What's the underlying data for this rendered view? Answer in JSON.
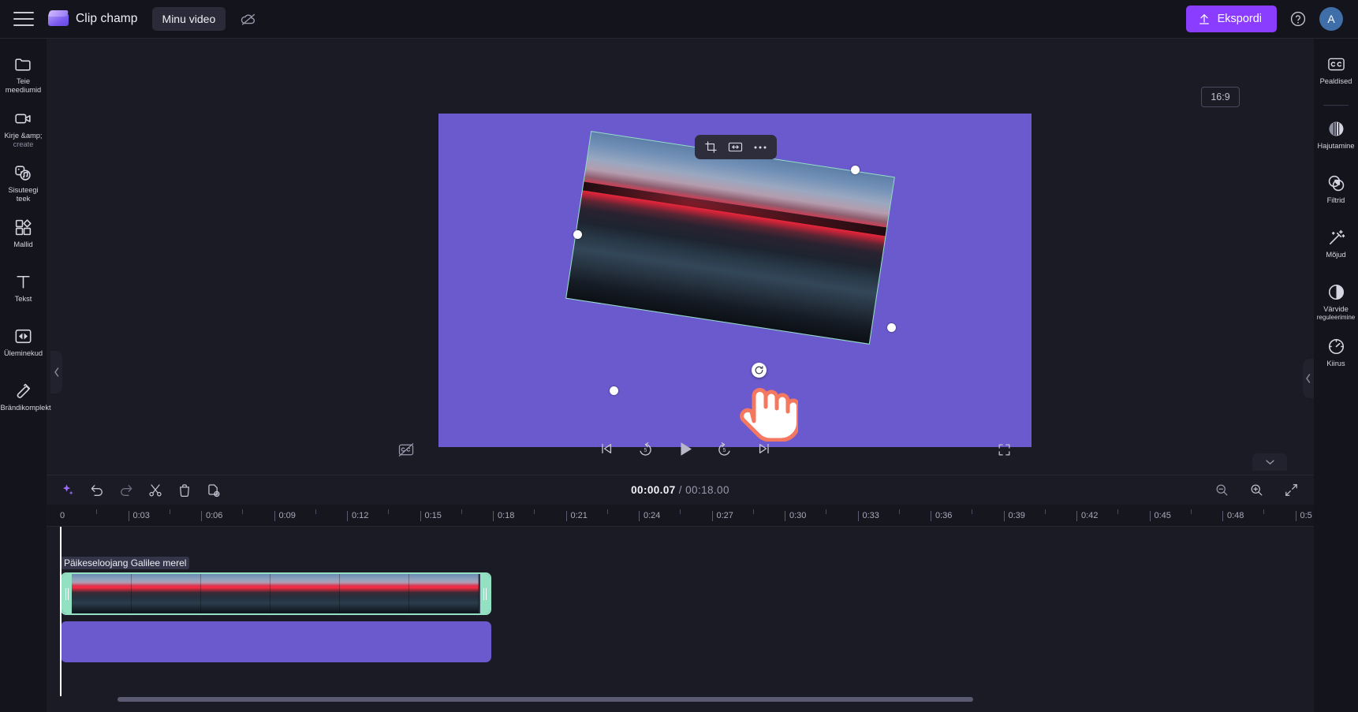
{
  "app": {
    "brand_name": "Clip champ",
    "project_name": "Minu video",
    "export_label": "Ekspordi",
    "avatar_initial": "A",
    "accent_color": "#8b3dff",
    "selection_color": "#93e0c3",
    "canvas_color": "#6a5acd"
  },
  "topbar": {
    "menu_icon": "hamburger-icon",
    "logo_icon": "clipchamp-logo-icon",
    "cloud_icon": "cloud-off-icon",
    "export_icon": "upload-arrow-icon",
    "help_icon": "question-circle-icon"
  },
  "left_rail": {
    "items": [
      {
        "label": "Teie meediumid",
        "icon": "folder-icon",
        "dim": false
      },
      {
        "label": "Kirje &amp;",
        "label2": "create",
        "icon": "video-camera-icon",
        "dim": false
      },
      {
        "label": "Sisuteegi",
        "label2": "teek",
        "icon": "content-library-icon",
        "dim": false
      },
      {
        "label": "Mallid",
        "icon": "templates-grid-icon",
        "dim": false
      },
      {
        "label": "Tekst",
        "icon": "text-t-icon",
        "dim": false
      },
      {
        "label": "Üleminekud",
        "icon": "transitions-icon",
        "dim": false
      },
      {
        "label": "Brändikomplekt",
        "icon": "brand-kit-icon",
        "dim": false
      }
    ],
    "collapse_icon": "chevron-left-icon"
  },
  "right_rail": {
    "items": [
      {
        "label": "Pealdised",
        "icon": "closed-captions-icon"
      },
      {
        "label": "Hajutamine",
        "icon": "fade-icon"
      },
      {
        "label": "Filtrid",
        "icon": "filters-icon"
      },
      {
        "label": "Mõjud",
        "icon": "effects-wand-icon"
      },
      {
        "label": "Värvide",
        "label2": "reguleerimine",
        "icon": "color-adjust-icon"
      },
      {
        "label": "Kiirus",
        "icon": "speed-gauge-icon"
      }
    ],
    "collapse_icon": "chevron-left-icon"
  },
  "preview": {
    "aspect_ratio": "16:9",
    "float_toolbar": [
      {
        "icon": "crop-icon",
        "name": "crop-button"
      },
      {
        "icon": "fit-width-icon",
        "name": "fit-button"
      },
      {
        "icon": "more-horizontal-icon",
        "name": "more-options-button"
      }
    ],
    "rotate_handle_icon": "rotate-icon",
    "cursor_icon": "hand-pointer-cursor"
  },
  "playback": {
    "captions_icon": "captions-off-icon",
    "skip_start_icon": "skip-to-start-icon",
    "back5_icon": "rewind-5-seconds-icon",
    "play_icon": "play-icon",
    "forward5_icon": "forward-5-seconds-icon",
    "skip_end_icon": "skip-to-end-icon",
    "fullscreen_icon": "fullscreen-icon",
    "panel_chevron_icon": "chevron-down-icon"
  },
  "timeline": {
    "tools": [
      {
        "icon": "ai-sparkle-icon",
        "name": "ai-tools-button"
      },
      {
        "icon": "undo-icon",
        "name": "undo-button"
      },
      {
        "icon": "redo-icon",
        "name": "redo-button"
      },
      {
        "icon": "scissors-icon",
        "name": "split-button"
      },
      {
        "icon": "trash-icon",
        "name": "delete-button"
      },
      {
        "icon": "duplicate-icon",
        "name": "duplicate-button"
      }
    ],
    "current_time": "00:00.07",
    "separator": "/",
    "total_time": "00:18.00",
    "zoom_out_icon": "zoom-out-icon",
    "zoom_in_icon": "zoom-in-icon",
    "fit_timeline_icon": "fit-to-screen-icon",
    "ruler_ticks": [
      "0",
      "0:03",
      "0:06",
      "0:09",
      "0:12",
      "0:15",
      "0:18",
      "0:21",
      "0:24",
      "0:27",
      "0:30",
      "0:33",
      "0:36",
      "0:39",
      "0:42",
      "0:45",
      "0:48",
      "0:5"
    ],
    "clip_label": "Päikeseloojang Galilee merel",
    "video_track_name": "video-clip",
    "audio_track_name": "audio-clip"
  }
}
